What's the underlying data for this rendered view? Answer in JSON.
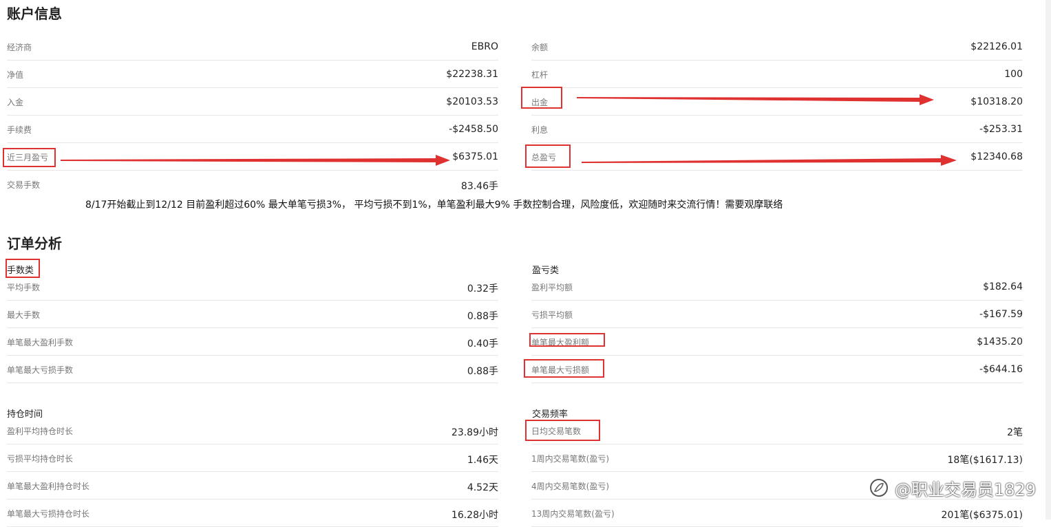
{
  "account": {
    "title": "账户信息",
    "left": [
      {
        "label": "经济商",
        "value": "EBRO"
      },
      {
        "label": "净值",
        "value": "$22238.31"
      },
      {
        "label": "入金",
        "value": "$20103.53"
      },
      {
        "label": "手续费",
        "value": "-$2458.50"
      },
      {
        "label": "近三月盈亏",
        "value": "$6375.01"
      },
      {
        "label": "交易手数",
        "value": "83.46手"
      }
    ],
    "right": [
      {
        "label": "余额",
        "value": "$22126.01"
      },
      {
        "label": "杠杆",
        "value": "100"
      },
      {
        "label": "出金",
        "value": "$10318.20"
      },
      {
        "label": "利息",
        "value": "-$253.31"
      },
      {
        "label": "总盈亏",
        "value": "$12340.68"
      }
    ]
  },
  "note": "8/17开始截止到12/12 目前盈利超过60% 最大单笔亏损3%， 平均亏损不到1%，单笔盈利最大9% 手数控制合理，风险度低，欢迎随时来交流行情！需要观摩联络",
  "orders": {
    "title": "订单分析",
    "lots": {
      "heading": "手数类",
      "rows": [
        {
          "label": "平均手数",
          "value": "0.32手"
        },
        {
          "label": "最大手数",
          "value": "0.88手"
        },
        {
          "label": "单笔最大盈利手数",
          "value": "0.40手"
        },
        {
          "label": "单笔最大亏损手数",
          "value": "0.88手"
        }
      ]
    },
    "pnl": {
      "heading": "盈亏类",
      "rows": [
        {
          "label": "盈利平均额",
          "value": "$182.64"
        },
        {
          "label": "亏损平均额",
          "value": "-$167.59"
        },
        {
          "label": "单笔最大盈利额",
          "value": "$1435.20"
        },
        {
          "label": "单笔最大亏损额",
          "value": "-$644.16"
        }
      ]
    },
    "holding": {
      "heading": "持仓时间",
      "rows": [
        {
          "label": "盈利平均持仓时长",
          "value": "23.89小时"
        },
        {
          "label": "亏损平均持仓时长",
          "value": "1.46天"
        },
        {
          "label": "单笔最大盈利持仓时长",
          "value": "4.52天"
        },
        {
          "label": "单笔最大亏损持仓时长",
          "value": "16.28小时"
        }
      ]
    },
    "frequency": {
      "heading": "交易频率",
      "rows": [
        {
          "label": "日均交易笔数",
          "value": "2笔"
        },
        {
          "label": "1周内交易笔数(盈亏)",
          "value": "18笔($1617.13)"
        },
        {
          "label": "4周内交易笔数(盈亏)",
          "value": ""
        },
        {
          "label": "13周内交易笔数(盈亏)",
          "value": "201笔($6375.01)"
        }
      ]
    }
  },
  "watermark": "@职业交易员1829",
  "colors": {
    "annotation": "#e03131"
  }
}
